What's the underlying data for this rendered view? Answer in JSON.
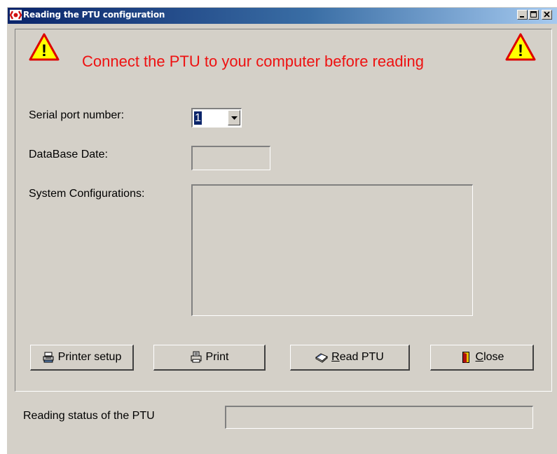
{
  "window": {
    "title": "Reading the PTU configuration",
    "controls": {
      "minimize": "_",
      "maximize": "□",
      "close": "X"
    }
  },
  "warning": {
    "text": "Connect the PTU to your computer before reading",
    "icon": "warning-triangle-icon",
    "color": "#ee1111"
  },
  "form": {
    "serial_port_label": "Serial port number:",
    "serial_port_value": "1",
    "database_date_label": "DataBase Date:",
    "database_date_value": "",
    "system_configurations_label": "System Configurations:",
    "system_configurations_value": ""
  },
  "buttons": {
    "printer_setup": "Printer setup",
    "print": "Print",
    "read_ptu_accel": "R",
    "read_ptu_rest": "ead PTU",
    "close_accel": "C",
    "close_rest": "lose"
  },
  "status": {
    "label": "Reading status of the PTU",
    "value": ""
  },
  "colors": {
    "face": "#d4d0c8",
    "titlebar_start": "#0a246a",
    "titlebar_end": "#a6caf0",
    "selection": "#0a246a"
  }
}
